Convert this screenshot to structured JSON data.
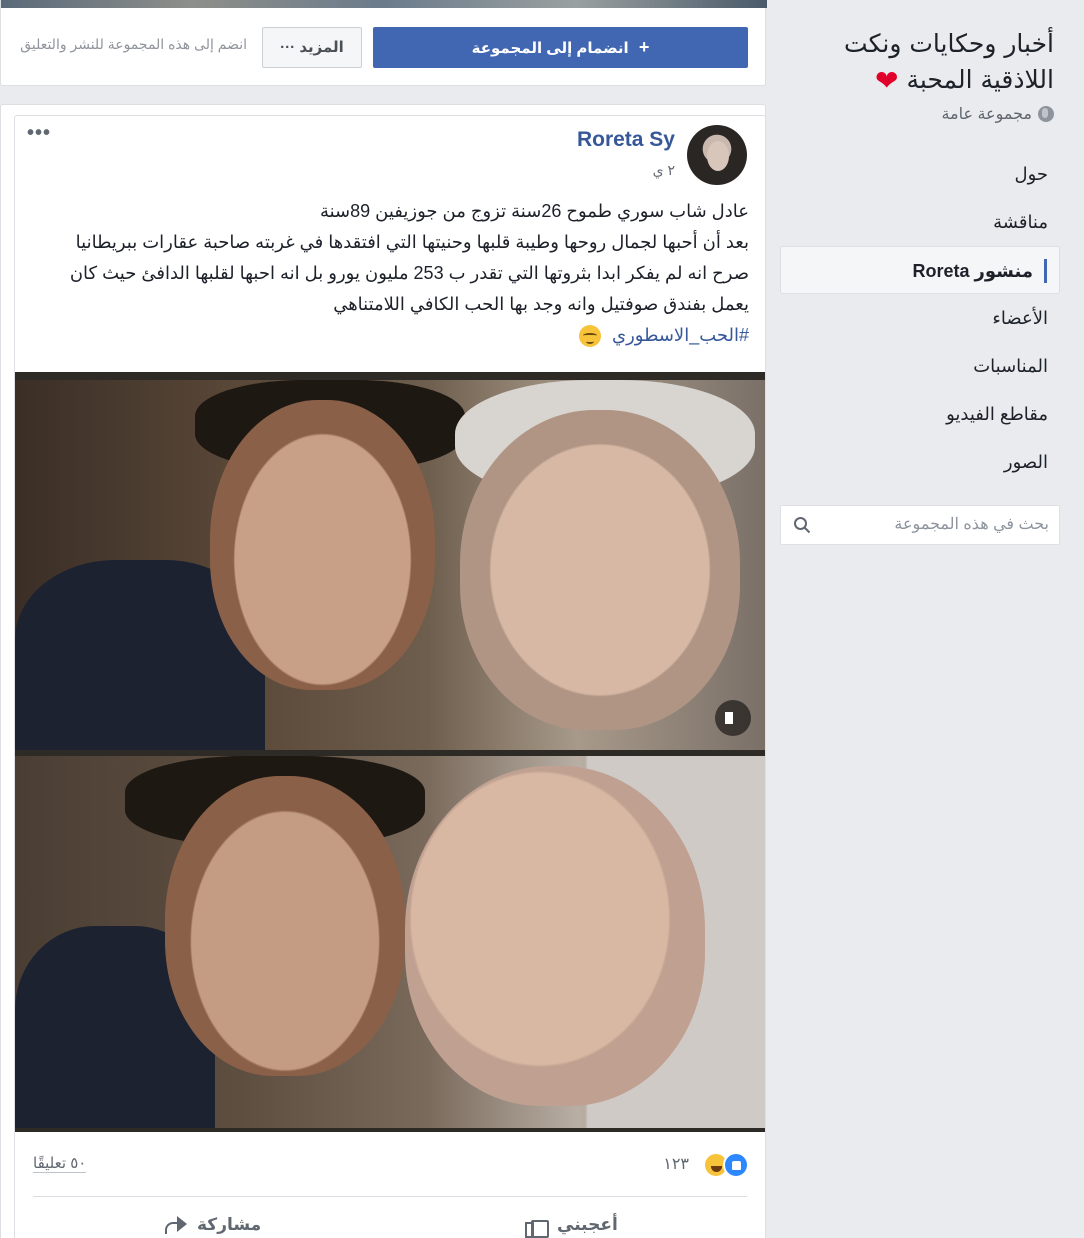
{
  "group": {
    "name_line1": "أخبار وحكايات ونكت",
    "name_line2": "اللاذقية المحبة",
    "heart_emoji": "❤",
    "type": "مجموعة عامة"
  },
  "nav": {
    "items": [
      {
        "label": "حول"
      },
      {
        "label": "مناقشة"
      },
      {
        "label": "منشور Roreta"
      },
      {
        "label": "الأعضاء"
      },
      {
        "label": "المناسبات"
      },
      {
        "label": "مقاطع الفيديو"
      },
      {
        "label": "الصور"
      }
    ],
    "active_index": 2
  },
  "search": {
    "placeholder": "بحث في هذه المجموعة"
  },
  "joinbar": {
    "join_label": "انضمام إلى المجموعة",
    "join_icon": "+",
    "more_label": "المزيد",
    "more_icon": "···",
    "hint": "انضم إلى هذه المجموعة للنشر والتعليق"
  },
  "post": {
    "author": "Roreta Sy",
    "time": "٢ ي",
    "menu": "•••",
    "text_lines": [
      "عادل شاب سوري طموح 26سنة تزوج من جوزيفين 89سنة",
      "بعد أن أحبها لجمال روحها وطيبة قلبها وحنيتها التي افتقدها في غربته صاحبة عقارات ببريطانيا",
      "صرح انه لم يفكر ابدا بثروتها التي تقدر ب 253 مليون يورو بل انه احبها لقلبها الدافئ حيث كان",
      "يعمل بفندق صوفتيل وانه وجد بها الحب الكافي اللامتناهي"
    ],
    "hashtag": "#الحب_الاسطوري",
    "reaction_count": "١٢٣",
    "comment_count": "٥٠ تعليقًا",
    "like_label": "أعجبني",
    "share_label": "مشاركة"
  },
  "colors": {
    "brand": "#4267b2",
    "link": "#365899",
    "background": "#e9ebee"
  }
}
